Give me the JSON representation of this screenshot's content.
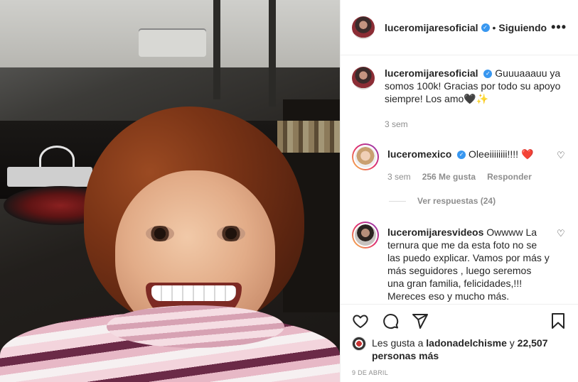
{
  "header": {
    "username": "luceromijaresoficial",
    "separator": "•",
    "follow_status": "Siguiendo",
    "more_label": "•••"
  },
  "caption": {
    "username": "luceromijaresoficial",
    "text": "Guuuaaauu ya somos 100k! Gracias por todo su apoyo siempre! Los amo",
    "emoji": "🖤✨",
    "time": "3 sem"
  },
  "comments": [
    {
      "username": "luceromexico",
      "text": "Oleeiiiiiiii!!!!",
      "emoji": "❤️",
      "time": "3 sem",
      "likes": "256 Me gusta",
      "reply_label": "Responder",
      "view_replies": "Ver respuestas (24)"
    },
    {
      "username": "luceromijaresvideos",
      "text": "Owwww La ternura que me da esta foto no se las puedo explicar. Vamos por más y más seguidores , luego seremos una gran familia, felicidades,!!! Mereces eso y mucho más."
    }
  ],
  "icons": {
    "like": "heart-icon",
    "comment": "comment-icon",
    "share": "share-icon",
    "save": "bookmark-icon"
  },
  "likes": {
    "prefix": "Les gusta a",
    "user": "ladonadelchisme",
    "connector": "y",
    "others": "22,507 personas más"
  },
  "date": "9 DE ABRIL",
  "colors": {
    "verified": "#3897f0",
    "text": "#262626",
    "secondary": "#8e8e8e",
    "like_red": "#ed4956"
  }
}
